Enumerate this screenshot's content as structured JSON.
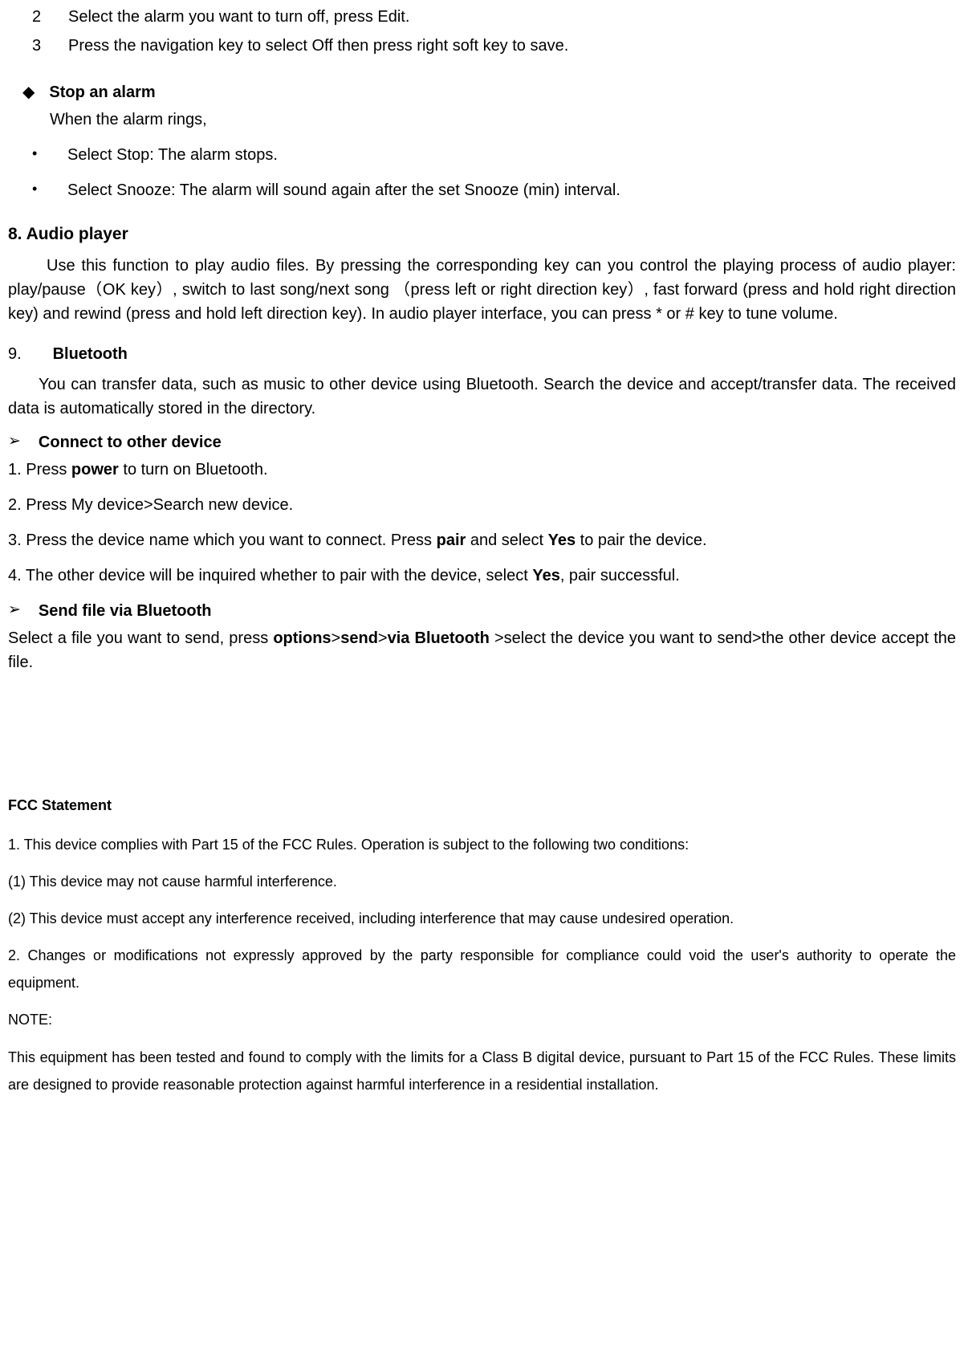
{
  "alarm_steps": {
    "s2": {
      "num": "2",
      "text": "Select the alarm you want to turn off, press Edit."
    },
    "s3": {
      "num": "3",
      "text": "Press the navigation key to select Off then press right soft key to save."
    }
  },
  "stop_alarm": {
    "title": "Stop an alarm",
    "intro": "When the alarm rings,",
    "b1": "Select Stop: The alarm stops.",
    "b2": "Select Snooze: The alarm will sound again after the set Snooze (min) interval."
  },
  "audio": {
    "heading": "8. Audio player",
    "body": "Use this function to play audio files. By pressing the corresponding key can you control the playing process of audio player: play/pause（OK key）, switch to last song/next song （press left or right direction key）, fast forward (press and hold right direction key) and rewind (press and hold left direction key). In audio player interface, you can press * or # key to tune volume."
  },
  "bluetooth": {
    "num": "9.",
    "title": "Bluetooth",
    "intro": "You can transfer data, such as music to other device using Bluetooth. Search the device and accept/transfer data. The received data is automatically stored in the directory.",
    "connect": {
      "title": "Connect to other device",
      "s1_pre": "1. Press ",
      "s1_bold": "power",
      "s1_post": " to turn on Bluetooth.",
      "s2": "2. Press My device>Search new device.",
      "s3_pre": "3. Press the device name which you want to connect. Press ",
      "s3_b1": "pair",
      "s3_mid": " and select ",
      "s3_b2": "Yes",
      "s3_post": " to pair the device.",
      "s4_pre": "4. The other device will be inquired whether to pair with the device, select ",
      "s4_b1": "Yes",
      "s4_post": ", pair successful."
    },
    "send": {
      "title": "Send file via Bluetooth",
      "body_pre": "Select a file you want to send, press ",
      "b1": "options",
      "sep1": ">",
      "b2": "send",
      "sep2": ">",
      "b3": "via Bluetooth",
      "body_post": " >select the device you want to send>the other device accept the file."
    }
  },
  "fcc": {
    "title": "FCC Statement",
    "l1": "1. This device complies with Part 15 of the FCC Rules. Operation is subject to the following two conditions:",
    "l2": "(1) This device may not cause harmful interference.",
    "l3": "(2) This device must accept any interference received, including interference that may cause undesired operation.",
    "l4": "2. Changes or modifications not expressly approved by the party responsible for compliance could void the user's authority to operate the equipment.",
    "l5": "NOTE:",
    "l6": "This equipment has been tested and found to comply with the limits for a Class B digital device, pursuant to Part 15 of the FCC Rules. These limits are designed to provide reasonable protection against harmful interference in a residential installation."
  }
}
